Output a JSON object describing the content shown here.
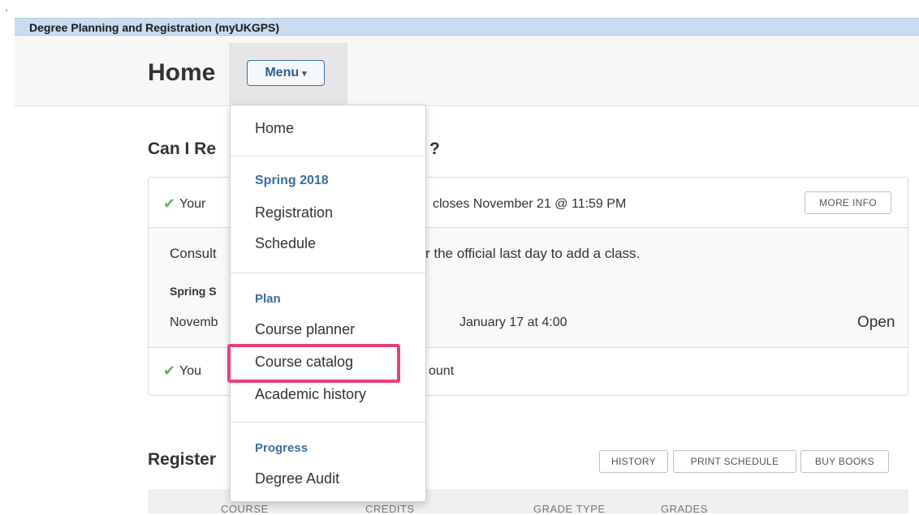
{
  "app": {
    "title": "Degree Planning and Registration (myUKGPS)"
  },
  "header": {
    "title": "Home",
    "menu_label": "Menu",
    "menu_caret": "▾"
  },
  "registration_section": {
    "title_left": "Can I Re",
    "title_right": "?",
    "status_row": {
      "check": "✔",
      "text_left": "Your",
      "text_right": "closes November 21 @ 11:59 PM",
      "button": "MORE INFO"
    },
    "consult_row": {
      "text_left": "Consult",
      "text_right": "r the official last day to add a class.",
      "term_label": "Spring S",
      "date_left": "Novemb",
      "date_middle": "January 17 at 4:00",
      "status": "Open"
    },
    "account_row": {
      "check": "✔",
      "text_left": "You",
      "text_right": "ount"
    }
  },
  "registered_section": {
    "title": "Register",
    "buttons": [
      "HISTORY",
      "PRINT SCHEDULE",
      "BUY BOOKS"
    ],
    "columns": [
      "COURSE",
      "CREDITS",
      "GRADE TYPE",
      "GRADES"
    ]
  },
  "dropdown_menu": {
    "home": "Home",
    "term_heading": "Spring 2018",
    "term_items": [
      "Registration",
      "Schedule"
    ],
    "plan_heading": "Plan",
    "plan_items": [
      "Course planner",
      "Course catalog",
      "Academic history"
    ],
    "progress_heading": "Progress",
    "progress_items": [
      "Degree Audit"
    ]
  },
  "colors": {
    "app_bar": "#c9dcf0",
    "accent": "#3a6ea5",
    "highlight": "#e8407c",
    "check": "#5cb85c"
  }
}
